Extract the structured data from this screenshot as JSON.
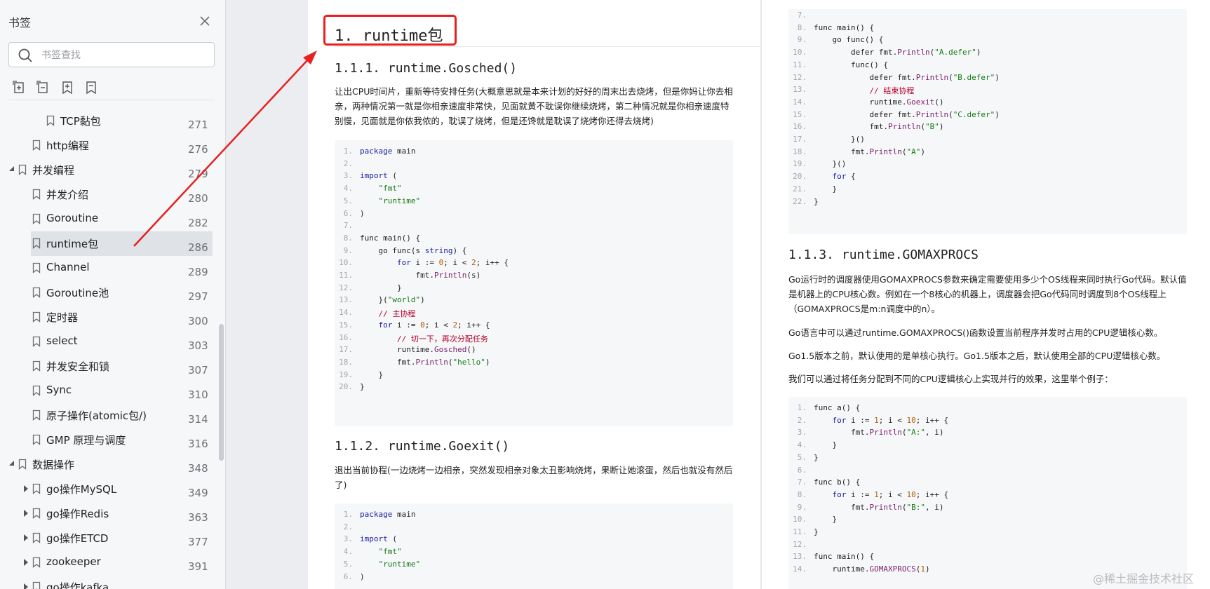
{
  "sidebar": {
    "title": "书签",
    "search_placeholder": "书签查找",
    "items": [
      {
        "label": "TCP黏包",
        "page": "271",
        "level": 2,
        "expander": "none"
      },
      {
        "label": "http编程",
        "page": "276",
        "level": 1,
        "expander": "none"
      },
      {
        "label": "并发编程",
        "page": "279",
        "level": 0,
        "expander": "expanded"
      },
      {
        "label": "并发介绍",
        "page": "280",
        "level": 1,
        "expander": "none"
      },
      {
        "label": "Goroutine",
        "page": "282",
        "level": 1,
        "expander": "none"
      },
      {
        "label": "runtime包",
        "page": "286",
        "level": 1,
        "expander": "none",
        "selected": true
      },
      {
        "label": "Channel",
        "page": "289",
        "level": 1,
        "expander": "none"
      },
      {
        "label": "Goroutine池",
        "page": "297",
        "level": 1,
        "expander": "none"
      },
      {
        "label": "定时器",
        "page": "300",
        "level": 1,
        "expander": "none"
      },
      {
        "label": "select",
        "page": "303",
        "level": 1,
        "expander": "none"
      },
      {
        "label": "并发安全和锁",
        "page": "307",
        "level": 1,
        "expander": "none"
      },
      {
        "label": "Sync",
        "page": "310",
        "level": 1,
        "expander": "none"
      },
      {
        "label": "原子操作(atomic包/)",
        "page": "314",
        "level": 1,
        "expander": "none"
      },
      {
        "label": "GMP 原理与调度",
        "page": "316",
        "level": 1,
        "expander": "none"
      },
      {
        "label": "数据操作",
        "page": "348",
        "level": 0,
        "expander": "expanded"
      },
      {
        "label": "go操作MySQL",
        "page": "349",
        "level": 1,
        "expander": "collapsed"
      },
      {
        "label": "go操作Redis",
        "page": "363",
        "level": 1,
        "expander": "collapsed"
      },
      {
        "label": "go操作ETCD",
        "page": "377",
        "level": 1,
        "expander": "collapsed"
      },
      {
        "label": "zookeeper",
        "page": "391",
        "level": 1,
        "expander": "collapsed"
      },
      {
        "label": "go操作kafka",
        "page": "",
        "level": 1,
        "expander": "collapsed"
      }
    ]
  },
  "page1": {
    "h1": "1. runtime包",
    "s1_title": "1.1.1. runtime.Gosched()",
    "s1_para": "让出CPU时间片，重新等待安排任务(大概意思就是本来计划的好好的周末出去烧烤，但是你妈让你去相亲，两种情况第一就是你相亲速度非常快，见面就黄不耽误你继续烧烤，第二种情况就是你相亲速度特别慢，见面就是你侬我侬的，耽误了烧烤，但是还馋就是耽误了烧烤你还得去烧烤)",
    "code1": [
      "package main",
      "",
      "import (",
      "    \"fmt\"",
      "    \"runtime\"",
      ")",
      "",
      "func main() {",
      "    go func(s string) {",
      "        for i := 0; i < 2; i++ {",
      "            fmt.Println(s)",
      "        }",
      "    }(\"world\")",
      "    // 主协程",
      "    for i := 0; i < 2; i++ {",
      "        // 切一下，再次分配任务",
      "        runtime.Gosched()",
      "        fmt.Println(\"hello\")",
      "    }",
      "}"
    ],
    "s2_title": "1.1.2. runtime.Goexit()",
    "s2_para": "退出当前协程(一边烧烤一边相亲，突然发现相亲对象太丑影响烧烤，果断让她滚蛋，然后也就没有然后了)",
    "code2": [
      "package main",
      "",
      "import (",
      "    \"fmt\"",
      "    \"runtime\"",
      ")"
    ]
  },
  "page2": {
    "code_top_start": 7,
    "code_top": [
      "",
      "func main() {",
      "    go func() {",
      "        defer fmt.Println(\"A.defer\")",
      "        func() {",
      "            defer fmt.Println(\"B.defer\")",
      "            // 结束协程",
      "            runtime.Goexit()",
      "            defer fmt.Println(\"C.defer\")",
      "            fmt.Println(\"B\")",
      "        }()",
      "        fmt.Println(\"A\")",
      "    }()",
      "    for {",
      "    }",
      "}"
    ],
    "s3_title": "1.1.3. runtime.GOMAXPROCS",
    "p1": "Go运行时的调度器使用GOMAXPROCS参数来确定需要使用多少个OS线程来同时执行Go代码。默认值是机器上的CPU核心数。例如在一个8核心的机器上，调度器会把Go代码同时调度到8个OS线程上（GOMAXPROCS是m:n调度中的n）。",
    "p2": "Go语言中可以通过runtime.GOMAXPROCS()函数设置当前程序并发时占用的CPU逻辑核心数。",
    "p3": "Go1.5版本之前，默认使用的是单核心执行。Go1.5版本之后，默认使用全部的CPU逻辑核心数。",
    "p4": "我们可以通过将任务分配到不同的CPU逻辑核心上实现并行的效果，这里举个例子：",
    "code_bottom": [
      "func a() {",
      "    for i := 1; i < 10; i++ {",
      "        fmt.Println(\"A:\", i)",
      "    }",
      "}",
      "",
      "func b() {",
      "    for i := 1; i < 10; i++ {",
      "        fmt.Println(\"B:\", i)",
      "    }",
      "}",
      "",
      "func main() {",
      "    runtime.GOMAXPROCS(1)"
    ]
  },
  "watermark": "@稀土掘金技术社区",
  "colors": {
    "annotation": "#e82020",
    "selected_row": "#dfe2e6",
    "keyword": "#1a21a6",
    "string": "#157a15",
    "function": "#7a1d6e",
    "number": "#b05b00",
    "comment": "#b8002e"
  }
}
